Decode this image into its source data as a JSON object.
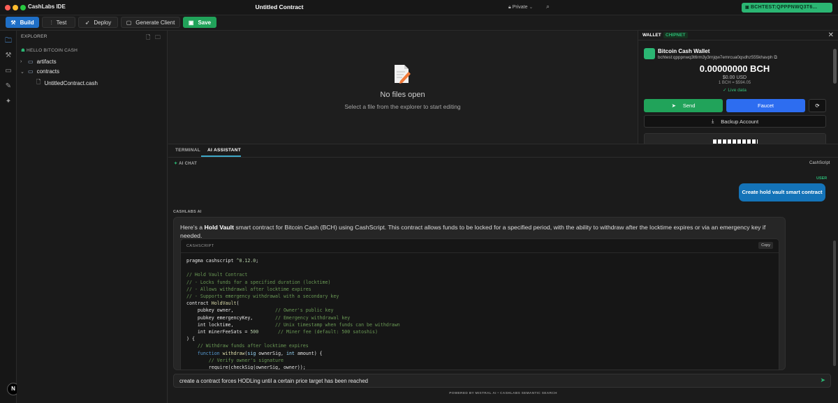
{
  "app": {
    "name": "CashLabs IDE",
    "document_title": "Untitled Contract",
    "privacy": "Private",
    "wallet_badge": "BCHTEST:QPPPNWQ3T6..."
  },
  "colors": {
    "close": "#ff5f57",
    "minimize": "#febc2e",
    "maximize": "#28c840",
    "accent_blue": "#1f6fc6",
    "accent_green": "#21a35a"
  },
  "toolbar": {
    "build": "Build",
    "test": "Test",
    "deploy": "Deploy",
    "generate_client": "Generate Client",
    "save": "Save"
  },
  "explorer": {
    "header": "EXPLORER",
    "project": "HELLO BITCOIN CASH",
    "items": [
      {
        "label": "artifacts",
        "type": "folder",
        "expanded": false
      },
      {
        "label": "contracts",
        "type": "folder",
        "expanded": true
      },
      {
        "label": "UntitledContract.cash",
        "type": "file"
      }
    ]
  },
  "editor": {
    "empty_title": "No files open",
    "empty_subtitle": "Select a file from the explorer to start editing"
  },
  "wallet": {
    "tab": "WALLET",
    "network": "CHIPNET",
    "name": "Bitcoin Cash Wallet",
    "address": "bchtest:qpppnwq3t6rm3y3rnjqw7emrcua0qsdhz555khavph",
    "balance": "0.00000000 BCH",
    "usd": "$0.00 USD",
    "rate": "1 BCH = $594.05",
    "live": "✓ Live data",
    "send": "Send",
    "faucet": "Faucet",
    "backup": "Backup Account"
  },
  "panel": {
    "tabs": [
      "TERMINAL",
      "AI ASSISTANT"
    ],
    "active_tab": "AI ASSISTANT",
    "chat_label": "AI CHAT",
    "language": "CashScript",
    "user_label": "USER",
    "user_message": "Create hold vault smart contract",
    "ai_label": "CASHLABS AI",
    "ai_intro_before": "Here's a ",
    "ai_intro_bold": "Hold Vault",
    "ai_intro_after": " smart contract for Bitcoin Cash (BCH) using CashScript. This contract allows funds to be locked for a specified period, with the ability to withdraw after the locktime expires or via an emergency key if needed.",
    "code_language": "CASHSCRIPT",
    "copy": "Copy",
    "input_value": "create a contract forces HODLing until a certain price target has been reached",
    "footer": "POWERED BY MISTRAL AI • CASHLABS SEMANTIC SEARCH"
  }
}
